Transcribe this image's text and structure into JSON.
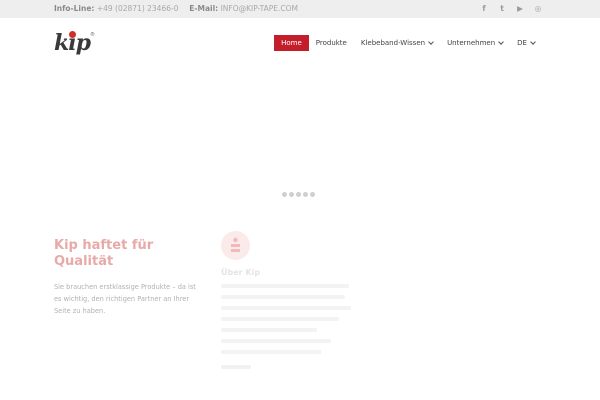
{
  "topbar": {
    "info_label": "Info-Line:",
    "info_phone": "+49 (02871) 23466-0",
    "email_label": "E-Mail:",
    "email_value": "INFO@KIP-TAPE.COM",
    "social_icons": [
      "facebook-icon",
      "twitter-icon",
      "youtube-icon",
      "instagram-icon"
    ],
    "social_glyphs": [
      "f",
      "t",
      "▶",
      "◎"
    ]
  },
  "header": {
    "logo_text": "kip",
    "logo_reg": "®",
    "nav": [
      {
        "label": "Home",
        "active": true,
        "dropdown": false
      },
      {
        "label": "Produkte",
        "active": false,
        "dropdown": false
      },
      {
        "label": "Klebeband-Wissen",
        "active": false,
        "dropdown": true
      },
      {
        "label": "Unternehmen",
        "active": false,
        "dropdown": true
      },
      {
        "label": "DE",
        "active": false,
        "dropdown": true
      }
    ]
  },
  "slider": {
    "dot_count": 5
  },
  "content": {
    "headline": "Kip haftet für Qualität",
    "intro": "Sie brauchen erstklassige Produkte – da ist es wichtig, den richtigen Partner an Ihrer Seite zu haben.",
    "about_title": "Über Kip"
  },
  "colors": {
    "accent": "#c41e2b",
    "headline": "#e8a9a9"
  }
}
